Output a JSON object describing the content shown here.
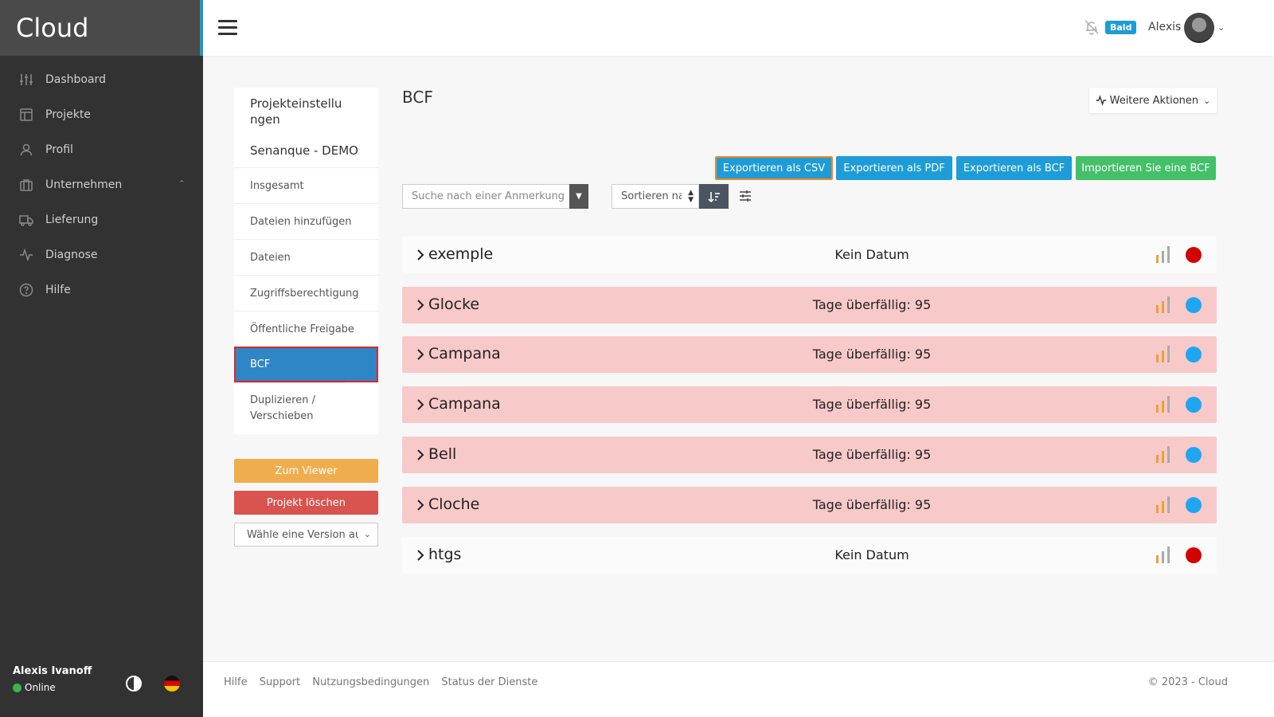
{
  "app": {
    "brand": "Cloud"
  },
  "sidebar": {
    "items": [
      {
        "label": "Dashboard",
        "icon": "sliders-icon"
      },
      {
        "label": "Projekte",
        "icon": "layout-icon"
      },
      {
        "label": "Profil",
        "icon": "user-icon"
      },
      {
        "label": "Unternehmen",
        "icon": "briefcase-icon"
      },
      {
        "label": "Lieferung",
        "icon": "truck-icon"
      },
      {
        "label": "Diagnose",
        "icon": "activity-icon"
      },
      {
        "label": "Hilfe",
        "icon": "help-circle-icon"
      }
    ],
    "user_name": "Alexis Ivanoff",
    "user_status": "Online",
    "status_color": "#3bb54a"
  },
  "header": {
    "badge": "Bald",
    "user_name": "Alexis"
  },
  "project_nav": {
    "title": "Projekteinstellungen",
    "project_name": "Senanque - DEMO",
    "items": [
      "Insgesamt",
      "Dateien hinzufügen",
      "Dateien",
      "Zugriffsberechtigung",
      "Öffentliche Freigabe",
      "BCF",
      "Duplizieren / Verschieben"
    ],
    "viewer_button": "Zum Viewer",
    "delete_button": "Projekt löschen",
    "version_placeholder": "Wähle eine Version aus"
  },
  "main": {
    "title": "BCF",
    "more_actions": "Weitere Aktionen",
    "buttons": {
      "export_csv": "Exportieren als CSV",
      "export_pdf": "Exportieren als PDF",
      "export_bcf": "Exportieren als BCF",
      "import_bcf": "Importieren Sie eine BCF"
    },
    "search_placeholder": "Suche nach einer Anmerkung",
    "sort_label": "Sortieren nach",
    "rows": [
      {
        "name": "exemple",
        "date": "Kein Datum",
        "overdue": false,
        "status_color": "#d40000"
      },
      {
        "name": "Glocke",
        "date": "Tage überfällig: 95",
        "overdue": true,
        "status_color": "#1ea7f0"
      },
      {
        "name": "Campana",
        "date": "Tage überfällig: 95",
        "overdue": true,
        "status_color": "#1ea7f0"
      },
      {
        "name": "Campana",
        "date": "Tage überfällig: 95",
        "overdue": true,
        "status_color": "#1ea7f0"
      },
      {
        "name": "Bell",
        "date": "Tage überfällig: 95",
        "overdue": true,
        "status_color": "#1ea7f0"
      },
      {
        "name": "Cloche",
        "date": "Tage überfällig: 95",
        "overdue": true,
        "status_color": "#1ea7f0"
      },
      {
        "name": "htgs",
        "date": "Kein Datum",
        "overdue": false,
        "status_color": "#d40000"
      }
    ]
  },
  "footer": {
    "links": [
      "Hilfe",
      "Support",
      "Nutzungsbedingungen",
      "Status der Dienste"
    ],
    "copyright": "© 2023 - Cloud"
  },
  "colors": {
    "accent_blue": "#1e9cd7",
    "green": "#43c068",
    "orange": "#f0ad4e",
    "red": "#d9534f",
    "overdue_row": "#f8c9c9"
  }
}
